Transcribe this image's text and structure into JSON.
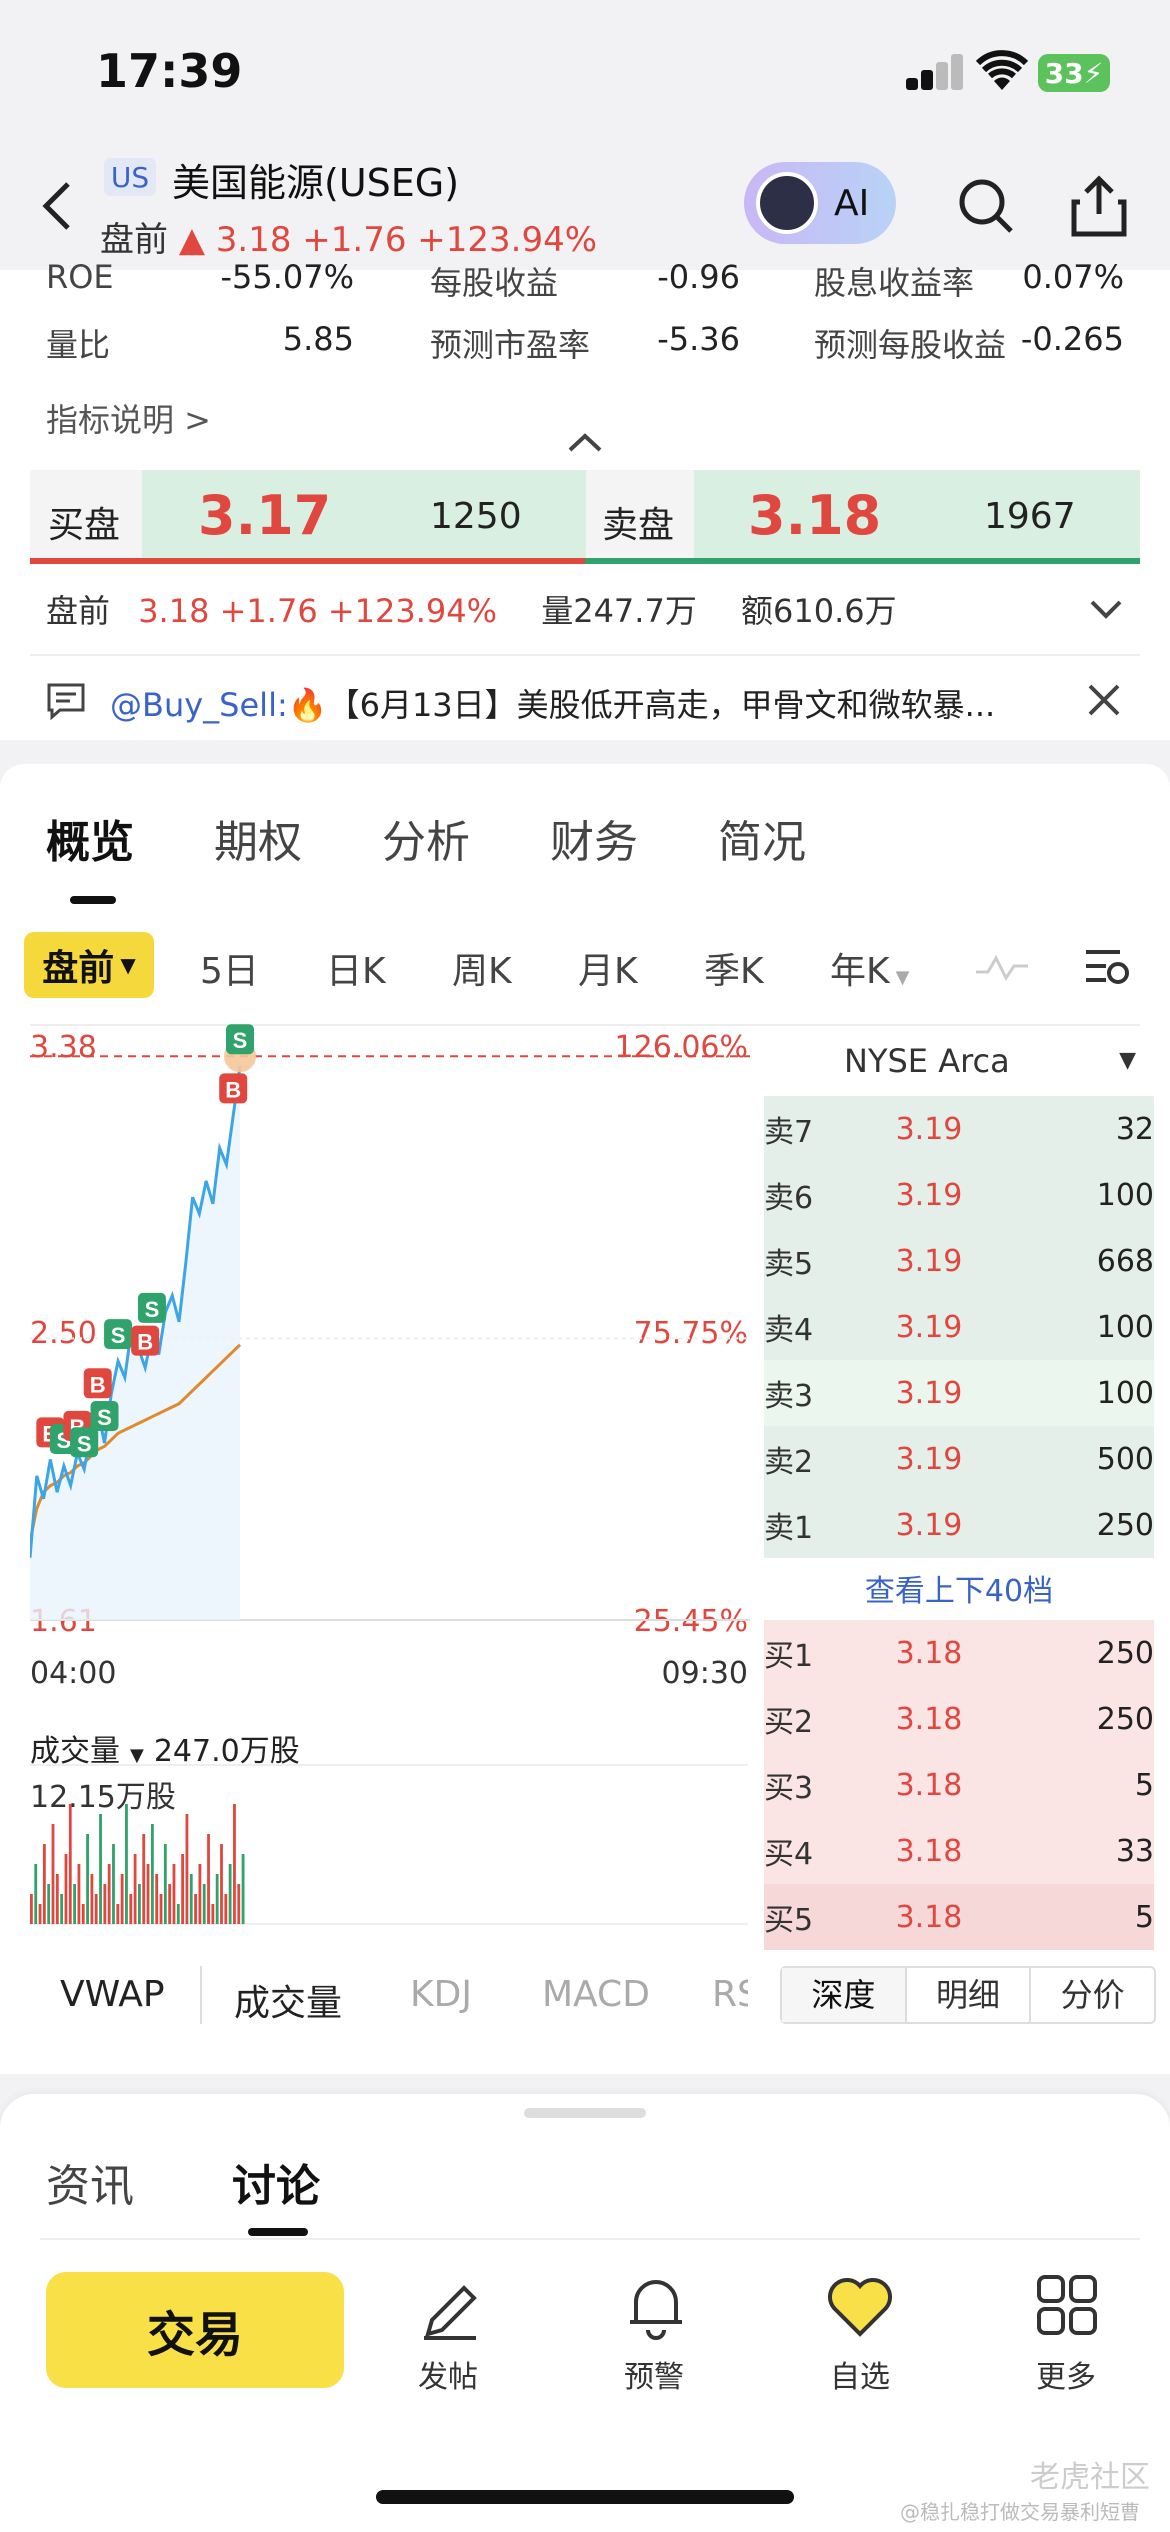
{
  "status_bar": {
    "time": "17:39",
    "battery": "33"
  },
  "header": {
    "market_badge": "US",
    "title": "美国能源(USEG)",
    "session": "盘前",
    "price_change": "▲ 3.18 +1.76 +123.94%",
    "ai_label": "AI"
  },
  "stats": {
    "row1": [
      {
        "label": "ROE",
        "value": "-55.07%"
      },
      {
        "label": "每股收益",
        "value": "-0.96"
      },
      {
        "label": "股息收益率",
        "value": "0.07%"
      }
    ],
    "row2": [
      {
        "label": "量比",
        "value": "5.85"
      },
      {
        "label": "预测市盈率",
        "value": "-5.36"
      },
      {
        "label": "预测每股收益",
        "value": "-0.265"
      }
    ],
    "indicator_link": "指标说明 >"
  },
  "bidask": {
    "bid_label": "买盘",
    "bid_price": "3.17",
    "bid_vol": "1250",
    "ask_label": "卖盘",
    "ask_price": "3.18",
    "ask_vol": "1967",
    "bid_fraction": 0.5
  },
  "premarket": {
    "label": "盘前",
    "change": "3.18 +1.76 +123.94%",
    "volume": "量247.7万",
    "amount": "额610.6万"
  },
  "news": {
    "user": "@Buy_Sell:",
    "fire": "🔥",
    "text": "【6月13日】美股低开高走，甲骨文和微软暴..."
  },
  "main_tabs": [
    "概览",
    "期权",
    "分析",
    "财务",
    "简况"
  ],
  "periods": {
    "active": "盘前",
    "items": [
      "5日",
      "日K",
      "周K",
      "月K",
      "季K",
      "年K"
    ]
  },
  "chart": {
    "y_top": "3.38",
    "y_mid": "2.50",
    "y_bot": "1.61",
    "pct_top": "126.06%",
    "pct_mid": "75.75%",
    "pct_bot": "25.45%",
    "x_start": "04:00",
    "x_end": "09:30",
    "volume_label": "成交量",
    "volume_total": "247.0万股",
    "volume_max": "12.15万股",
    "colors": {
      "price": "#3ca5e6",
      "avg": "#e08a2c",
      "up": "#e0483f",
      "down": "#2fa36b"
    }
  },
  "chart_data": {
    "type": "line",
    "ylim": [
      1.61,
      3.38
    ],
    "x_range": [
      "04:00",
      "09:30"
    ],
    "series": [
      {
        "values": [
          1.8,
          2.05,
          1.98,
          2.1,
          2.0,
          2.08,
          2.02,
          2.12,
          2.07,
          2.18,
          2.25,
          2.15,
          2.3,
          2.4,
          2.35,
          2.5,
          2.44,
          2.38,
          2.48,
          2.42,
          2.55,
          2.6,
          2.52,
          2.7,
          2.9,
          2.85,
          2.95,
          2.88,
          3.05,
          3.0,
          3.15,
          3.3
        ]
      },
      {
        "values": [
          1.85,
          1.95,
          2.0,
          2.02,
          2.03,
          2.05,
          2.06,
          2.08,
          2.09,
          2.11,
          2.13,
          2.14,
          2.16,
          2.18,
          2.19,
          2.2,
          2.21,
          2.22,
          2.23,
          2.24,
          2.25,
          2.26,
          2.27,
          2.29,
          2.31,
          2.33,
          2.35,
          2.37,
          2.39,
          2.41,
          2.43,
          2.45
        ]
      }
    ],
    "volume": [
      3,
      6,
      2,
      8,
      4,
      10,
      5,
      3,
      7,
      12,
      4,
      6,
      2,
      9,
      5,
      3,
      11,
      4,
      6,
      8,
      2,
      5,
      12,
      3,
      7,
      4,
      9,
      6,
      10,
      5,
      3,
      8,
      4,
      6,
      2,
      7,
      11,
      5,
      3,
      6,
      4,
      9,
      2,
      5,
      8,
      3,
      6,
      12,
      4,
      7
    ],
    "markers": [
      {
        "label": "B",
        "i": 3,
        "type": "B"
      },
      {
        "label": "S",
        "i": 5,
        "type": "S"
      },
      {
        "label": "B",
        "i": 7,
        "type": "B"
      },
      {
        "label": "S",
        "i": 8,
        "type": "S"
      },
      {
        "label": "B",
        "i": 10,
        "type": "B"
      },
      {
        "label": "S",
        "i": 11,
        "type": "S"
      },
      {
        "label": "S",
        "i": 13,
        "type": "S"
      },
      {
        "label": "B",
        "i": 17,
        "type": "B"
      },
      {
        "label": "S",
        "i": 18,
        "type": "S"
      },
      {
        "label": "B",
        "i": 30,
        "type": "B"
      },
      {
        "label": "S",
        "i": 31,
        "type": "S"
      }
    ]
  },
  "depth": {
    "exchange": "NYSE Arca",
    "asks": [
      {
        "label": "卖7",
        "price": "3.19",
        "vol": "32"
      },
      {
        "label": "卖6",
        "price": "3.19",
        "vol": "100"
      },
      {
        "label": "卖5",
        "price": "3.19",
        "vol": "668"
      },
      {
        "label": "卖4",
        "price": "3.19",
        "vol": "100"
      },
      {
        "label": "卖3",
        "price": "3.19",
        "vol": "100"
      },
      {
        "label": "卖2",
        "price": "3.19",
        "vol": "500"
      },
      {
        "label": "卖1",
        "price": "3.19",
        "vol": "250"
      }
    ],
    "view_more": "查看上下40档",
    "bids": [
      {
        "label": "买1",
        "price": "3.18",
        "vol": "250"
      },
      {
        "label": "买2",
        "price": "3.18",
        "vol": "250"
      },
      {
        "label": "买3",
        "price": "3.18",
        "vol": "5"
      },
      {
        "label": "买4",
        "price": "3.18",
        "vol": "33"
      },
      {
        "label": "买5",
        "price": "3.18",
        "vol": "5"
      }
    ],
    "tabs": [
      "深度",
      "明细",
      "分价"
    ]
  },
  "indicators": [
    "VWAP",
    "成交量",
    "KDJ",
    "MACD",
    "RS"
  ],
  "bottom_tabs": [
    "资讯",
    "讨论"
  ],
  "bottom_nav": {
    "trade": "交易",
    "items": [
      "发帖",
      "预警",
      "自选",
      "更多"
    ]
  },
  "watermark": {
    "brand": "老虎社区",
    "user": "@稳扎稳打做交易暴利短曹"
  }
}
